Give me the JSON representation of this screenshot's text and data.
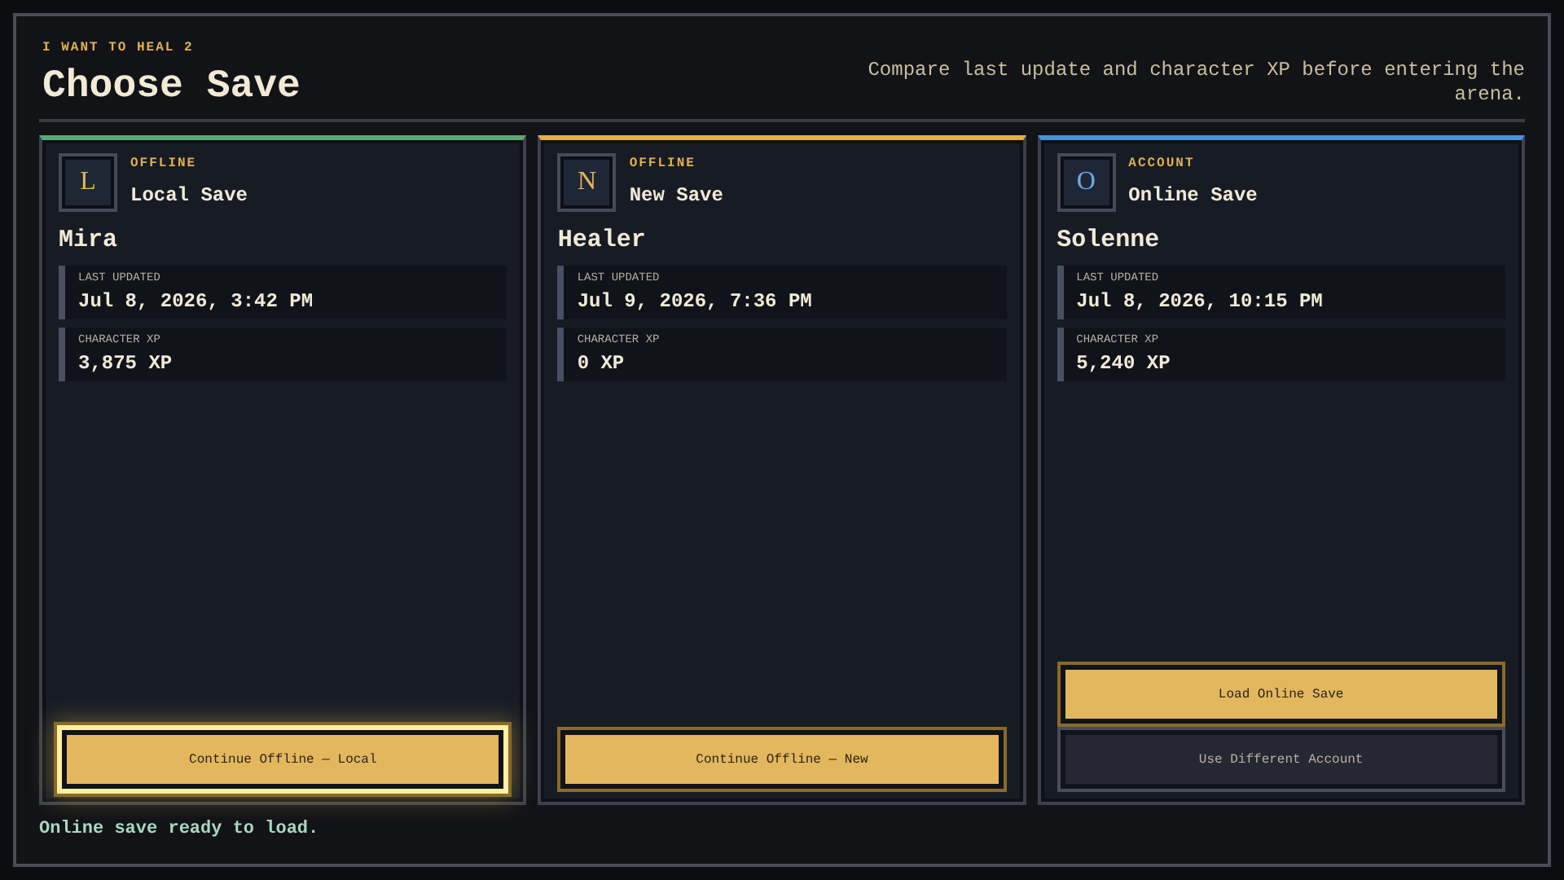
{
  "header": {
    "kicker": "I WANT TO HEAL 2",
    "title": "Choose Save",
    "subtitle": "Compare last update and character XP before entering the arena."
  },
  "cards": [
    {
      "kind": "offline",
      "color": "#5aa874",
      "initial": "L",
      "tag": "OFFLINE",
      "name": "Local Save",
      "character": "Mira",
      "stats": [
        {
          "label": "LAST UPDATED",
          "value": "Jul 8, 2026, 3:42 PM"
        },
        {
          "label": "CHARACTER XP",
          "value": "3,875 XP"
        }
      ],
      "buttons": [
        {
          "kind": "primary",
          "label": "Continue Offline — Local",
          "focused": true
        }
      ]
    },
    {
      "kind": "offline",
      "color": "#e0b050",
      "initial": "N",
      "tag": "OFFLINE",
      "name": "New Save",
      "character": "Healer",
      "stats": [
        {
          "label": "LAST UPDATED",
          "value": "Jul 9, 2026, 7:36 PM"
        },
        {
          "label": "CHARACTER XP",
          "value": "0 XP"
        }
      ],
      "buttons": [
        {
          "kind": "primary",
          "label": "Continue Offline — New",
          "focused": false
        }
      ]
    },
    {
      "kind": "account",
      "color": "#4a90d9",
      "initial": "O",
      "tag": "ACCOUNT",
      "name": "Online Save",
      "character": "Solenne",
      "stats": [
        {
          "label": "LAST UPDATED",
          "value": "Jul 8, 2026, 10:15 PM"
        },
        {
          "label": "CHARACTER XP",
          "value": "5,240 XP"
        }
      ],
      "buttons": [
        {
          "kind": "primary",
          "label": "Load Online Save",
          "focused": false
        },
        {
          "kind": "secondary",
          "label": "Use Different Account",
          "focused": false
        }
      ]
    }
  ],
  "status": "Online save ready to load."
}
